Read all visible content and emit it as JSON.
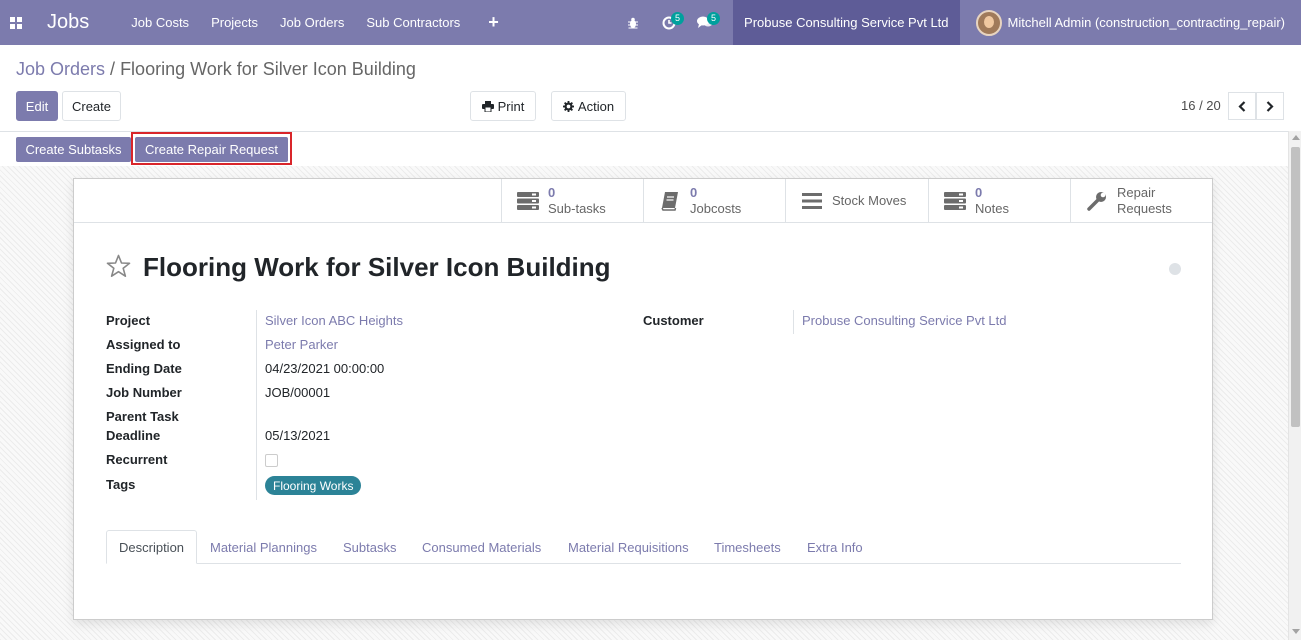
{
  "navbar": {
    "app_name": "Jobs",
    "menu": [
      "Job Costs",
      "Projects",
      "Job Orders",
      "Sub Contractors"
    ],
    "plus": "+",
    "activity_badge": "5",
    "messages_badge": "5",
    "company": "Probuse Consulting Service Pvt Ltd",
    "user": "Mitchell Admin (construction_contracting_repair)"
  },
  "breadcrumb": {
    "parent": "Job Orders",
    "separator": "/",
    "current": "Flooring Work for Silver Icon Building"
  },
  "buttons": {
    "edit": "Edit",
    "create": "Create",
    "print": "Print",
    "action": "Action"
  },
  "pager": {
    "value": "16 / 20"
  },
  "statusbar": {
    "create_subtasks": "Create Subtasks",
    "create_repair_request": "Create Repair Request"
  },
  "smart_buttons": {
    "subtasks": {
      "count": "0",
      "label": "Sub-tasks"
    },
    "jobcosts": {
      "count": "0",
      "label": "Jobcosts"
    },
    "stock_moves": {
      "label": "Stock Moves"
    },
    "notes": {
      "count": "0",
      "label": "Notes"
    },
    "repair": {
      "line1": "Repair",
      "line2": "Requests"
    }
  },
  "record": {
    "title": "Flooring Work for Silver Icon Building",
    "fields": {
      "project_label": "Project",
      "project_value": "Silver Icon ABC Heights",
      "assigned_label": "Assigned to",
      "assigned_value": "Peter Parker",
      "ending_label": "Ending Date",
      "ending_value": "04/23/2021 00:00:00",
      "jobnum_label": "Job Number",
      "jobnum_value": "JOB/00001",
      "parent_label": "Parent Task",
      "deadline_label": "Deadline",
      "deadline_value": "05/13/2021",
      "recurrent_label": "Recurrent",
      "tags_label": "Tags",
      "tag_value": "Flooring Works",
      "customer_label": "Customer",
      "customer_value": "Probuse Consulting Service Pvt Ltd"
    }
  },
  "tabs": [
    "Description",
    "Material Plannings",
    "Subtasks",
    "Consumed Materials",
    "Material Requisitions",
    "Timesheets",
    "Extra Info"
  ],
  "colors": {
    "brand": "#7c7bad",
    "brand_dark": "#5e5c97",
    "tag": "#2c8397",
    "highlight": "#d9252a"
  }
}
